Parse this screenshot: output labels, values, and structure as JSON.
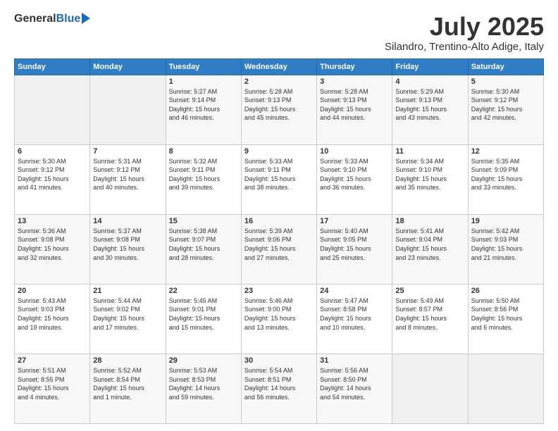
{
  "logo": {
    "general": "General",
    "blue": "Blue"
  },
  "title": "July 2025",
  "location": "Silandro, Trentino-Alto Adige, Italy",
  "days_of_week": [
    "Sunday",
    "Monday",
    "Tuesday",
    "Wednesday",
    "Thursday",
    "Friday",
    "Saturday"
  ],
  "weeks": [
    [
      {
        "day": "",
        "info": ""
      },
      {
        "day": "",
        "info": ""
      },
      {
        "day": "1",
        "info": "Sunrise: 5:27 AM\nSunset: 9:14 PM\nDaylight: 15 hours\nand 46 minutes."
      },
      {
        "day": "2",
        "info": "Sunrise: 5:28 AM\nSunset: 9:13 PM\nDaylight: 15 hours\nand 45 minutes."
      },
      {
        "day": "3",
        "info": "Sunrise: 5:28 AM\nSunset: 9:13 PM\nDaylight: 15 hours\nand 44 minutes."
      },
      {
        "day": "4",
        "info": "Sunrise: 5:29 AM\nSunset: 9:13 PM\nDaylight: 15 hours\nand 43 minutes."
      },
      {
        "day": "5",
        "info": "Sunrise: 5:30 AM\nSunset: 9:12 PM\nDaylight: 15 hours\nand 42 minutes."
      }
    ],
    [
      {
        "day": "6",
        "info": "Sunrise: 5:30 AM\nSunset: 9:12 PM\nDaylight: 15 hours\nand 41 minutes."
      },
      {
        "day": "7",
        "info": "Sunrise: 5:31 AM\nSunset: 9:12 PM\nDaylight: 15 hours\nand 40 minutes."
      },
      {
        "day": "8",
        "info": "Sunrise: 5:32 AM\nSunset: 9:11 PM\nDaylight: 15 hours\nand 39 minutes."
      },
      {
        "day": "9",
        "info": "Sunrise: 5:33 AM\nSunset: 9:11 PM\nDaylight: 15 hours\nand 38 minutes."
      },
      {
        "day": "10",
        "info": "Sunrise: 5:33 AM\nSunset: 9:10 PM\nDaylight: 15 hours\nand 36 minutes."
      },
      {
        "day": "11",
        "info": "Sunrise: 5:34 AM\nSunset: 9:10 PM\nDaylight: 15 hours\nand 35 minutes."
      },
      {
        "day": "12",
        "info": "Sunrise: 5:35 AM\nSunset: 9:09 PM\nDaylight: 15 hours\nand 33 minutes."
      }
    ],
    [
      {
        "day": "13",
        "info": "Sunrise: 5:36 AM\nSunset: 9:08 PM\nDaylight: 15 hours\nand 32 minutes."
      },
      {
        "day": "14",
        "info": "Sunrise: 5:37 AM\nSunset: 9:08 PM\nDaylight: 15 hours\nand 30 minutes."
      },
      {
        "day": "15",
        "info": "Sunrise: 5:38 AM\nSunset: 9:07 PM\nDaylight: 15 hours\nand 28 minutes."
      },
      {
        "day": "16",
        "info": "Sunrise: 5:39 AM\nSunset: 9:06 PM\nDaylight: 15 hours\nand 27 minutes."
      },
      {
        "day": "17",
        "info": "Sunrise: 5:40 AM\nSunset: 9:05 PM\nDaylight: 15 hours\nand 25 minutes."
      },
      {
        "day": "18",
        "info": "Sunrise: 5:41 AM\nSunset: 9:04 PM\nDaylight: 15 hours\nand 23 minutes."
      },
      {
        "day": "19",
        "info": "Sunrise: 5:42 AM\nSunset: 9:03 PM\nDaylight: 15 hours\nand 21 minutes."
      }
    ],
    [
      {
        "day": "20",
        "info": "Sunrise: 5:43 AM\nSunset: 9:03 PM\nDaylight: 15 hours\nand 19 minutes."
      },
      {
        "day": "21",
        "info": "Sunrise: 5:44 AM\nSunset: 9:02 PM\nDaylight: 15 hours\nand 17 minutes."
      },
      {
        "day": "22",
        "info": "Sunrise: 5:45 AM\nSunset: 9:01 PM\nDaylight: 15 hours\nand 15 minutes."
      },
      {
        "day": "23",
        "info": "Sunrise: 5:46 AM\nSunset: 9:00 PM\nDaylight: 15 hours\nand 13 minutes."
      },
      {
        "day": "24",
        "info": "Sunrise: 5:47 AM\nSunset: 8:58 PM\nDaylight: 15 hours\nand 10 minutes."
      },
      {
        "day": "25",
        "info": "Sunrise: 5:49 AM\nSunset: 8:57 PM\nDaylight: 15 hours\nand 8 minutes."
      },
      {
        "day": "26",
        "info": "Sunrise: 5:50 AM\nSunset: 8:56 PM\nDaylight: 15 hours\nand 6 minutes."
      }
    ],
    [
      {
        "day": "27",
        "info": "Sunrise: 5:51 AM\nSunset: 8:55 PM\nDaylight: 15 hours\nand 4 minutes."
      },
      {
        "day": "28",
        "info": "Sunrise: 5:52 AM\nSunset: 8:54 PM\nDaylight: 15 hours\nand 1 minute."
      },
      {
        "day": "29",
        "info": "Sunrise: 5:53 AM\nSunset: 8:53 PM\nDaylight: 14 hours\nand 59 minutes."
      },
      {
        "day": "30",
        "info": "Sunrise: 5:54 AM\nSunset: 8:51 PM\nDaylight: 14 hours\nand 56 minutes."
      },
      {
        "day": "31",
        "info": "Sunrise: 5:56 AM\nSunset: 8:50 PM\nDaylight: 14 hours\nand 54 minutes."
      },
      {
        "day": "",
        "info": ""
      },
      {
        "day": "",
        "info": ""
      }
    ]
  ]
}
